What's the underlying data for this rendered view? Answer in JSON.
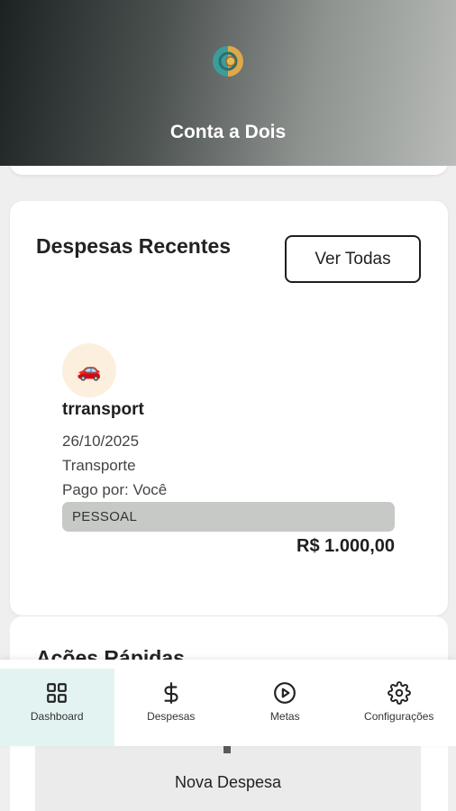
{
  "header": {
    "title": "Conta a Dois",
    "logo_icon": "couple-coin-logo"
  },
  "recent_expenses": {
    "title": "Despesas Recentes",
    "view_all_label": "Ver Todas",
    "items": [
      {
        "icon": "car-emoji",
        "icon_glyph": "🚗",
        "name": "trransport",
        "date": "26/10/2025",
        "category": "Transporte",
        "paid_by": "Pago por: Você",
        "tag": "PESSOAL",
        "amount": "R$ 1.000,00"
      }
    ]
  },
  "quick_actions": {
    "title": "Ações Rápidas",
    "new_expense_label": "Nova Despesa"
  },
  "bottom_nav": {
    "items": [
      {
        "label": "Dashboard",
        "icon": "grid-icon",
        "active": true
      },
      {
        "label": "Despesas",
        "icon": "dollar-icon",
        "active": false
      },
      {
        "label": "Metas",
        "icon": "play-circle-icon",
        "active": false
      },
      {
        "label": "Configurações",
        "icon": "gear-icon",
        "active": false
      }
    ]
  },
  "colors": {
    "accent_active_bg": "#e3f3f1",
    "tag_bg": "#c6c9c6",
    "icon_circle_bg": "#fcefdd"
  }
}
